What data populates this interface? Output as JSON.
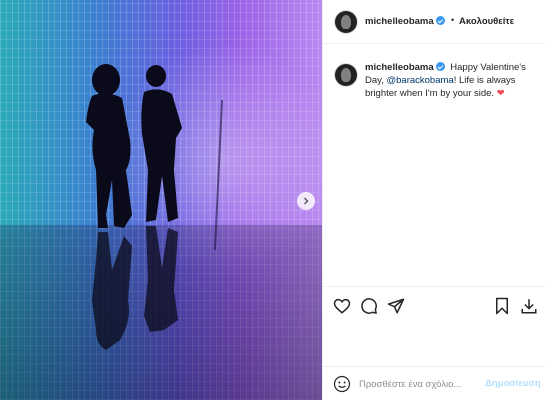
{
  "post": {
    "username": "michelleobama",
    "follow_label": "Ακολουθείτε",
    "separator": "•",
    "caption": {
      "text_before_mention": "Happy Valentine's Day,",
      "mention": "@barackobama",
      "text_after_mention": "! Life is always brighter when I'm by your side.",
      "emoji": "❤"
    }
  },
  "comment": {
    "placeholder": "Προσθέστε ένα σχόλιο...",
    "post_label": "Δημοσίευση"
  },
  "colors": {
    "accent": "#3897f0",
    "heart": "#ed4956",
    "post_disabled": "#b2dffc"
  },
  "icons": [
    "verified-icon",
    "chevron-right-icon",
    "heart-icon",
    "comment-icon",
    "share-icon",
    "bookmark-icon",
    "download-icon",
    "emoji-icon"
  ]
}
